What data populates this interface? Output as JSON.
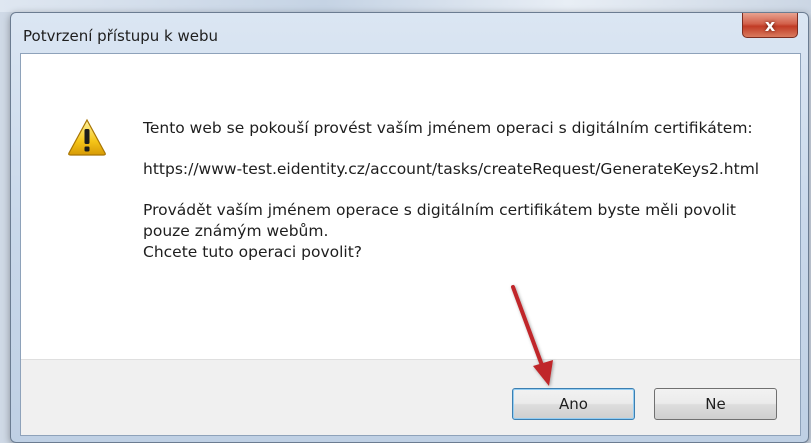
{
  "dialog": {
    "title": "Potvrzení přístupu k webu",
    "close_glyph": "x",
    "icon": "warning-icon",
    "message_line1": "Tento web se pokouší provést vaším jménem operaci s digitálním certifikátem:",
    "url": "https://www-test.eidentity.cz/account/tasks/createRequest/GenerateKeys2.html",
    "message_line2": "Provádět vaším jménem operace s digitálním certifikátem byste měli povolit pouze známým webům.",
    "question": "Chcete tuto operaci povolit?",
    "buttons": {
      "yes": "Ano",
      "no": "Ne"
    }
  },
  "annotation": {
    "arrow_color": "#c0282a",
    "points_to": "Ano"
  },
  "colors": {
    "close_red": "#c13b25",
    "titlebar": "#c9d8ea",
    "footer": "#f0f0f0"
  }
}
